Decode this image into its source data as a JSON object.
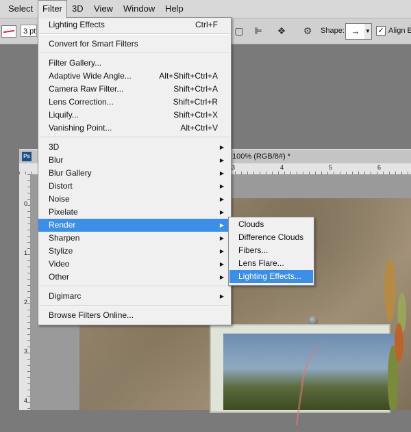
{
  "menubar": {
    "items": [
      "Select",
      "Filter",
      "3D",
      "View",
      "Window",
      "Help"
    ],
    "open_menu": "Filter"
  },
  "options_bar": {
    "stroke_value": "3 pt",
    "shape_label": "Shape:",
    "shape_glyph": "→",
    "align_label": "Align Ed",
    "align_checked": true
  },
  "document": {
    "badge": "Ps",
    "title_suffix": "100% (RGB/8#) *",
    "ruler_top": [
      "3",
      "4",
      "5",
      "6"
    ],
    "ruler_left": [
      "0",
      "1",
      "2",
      "3",
      "4"
    ]
  },
  "filter_menu": {
    "sections": [
      [
        {
          "label": "Lighting Effects",
          "shortcut": "Ctrl+F"
        }
      ],
      [
        {
          "label": "Convert for Smart Filters"
        }
      ],
      [
        {
          "label": "Filter Gallery..."
        },
        {
          "label": "Adaptive Wide Angle...",
          "shortcut": "Alt+Shift+Ctrl+A"
        },
        {
          "label": "Camera Raw Filter...",
          "shortcut": "Shift+Ctrl+A"
        },
        {
          "label": "Lens Correction...",
          "shortcut": "Shift+Ctrl+R"
        },
        {
          "label": "Liquify...",
          "shortcut": "Shift+Ctrl+X"
        },
        {
          "label": "Vanishing Point...",
          "shortcut": "Alt+Ctrl+V"
        }
      ],
      [
        {
          "label": "3D",
          "submenu": true
        },
        {
          "label": "Blur",
          "submenu": true
        },
        {
          "label": "Blur Gallery",
          "submenu": true
        },
        {
          "label": "Distort",
          "submenu": true
        },
        {
          "label": "Noise",
          "submenu": true
        },
        {
          "label": "Pixelate",
          "submenu": true
        },
        {
          "label": "Render",
          "submenu": true,
          "highlighted": true
        },
        {
          "label": "Sharpen",
          "submenu": true
        },
        {
          "label": "Stylize",
          "submenu": true
        },
        {
          "label": "Video",
          "submenu": true
        },
        {
          "label": "Other",
          "submenu": true
        }
      ],
      [
        {
          "label": "Digimarc",
          "submenu": true
        }
      ],
      [
        {
          "label": "Browse Filters Online..."
        }
      ]
    ]
  },
  "render_submenu": {
    "items": [
      {
        "label": "Clouds"
      },
      {
        "label": "Difference Clouds"
      },
      {
        "label": "Fibers..."
      },
      {
        "label": "Lens Flare..."
      },
      {
        "label": "Lighting Effects...",
        "highlighted": true
      }
    ]
  },
  "colors": {
    "highlight": "#3d8ee8",
    "menu_bg": "#f0f0f0",
    "menubar_bg": "#d8d8d8"
  }
}
